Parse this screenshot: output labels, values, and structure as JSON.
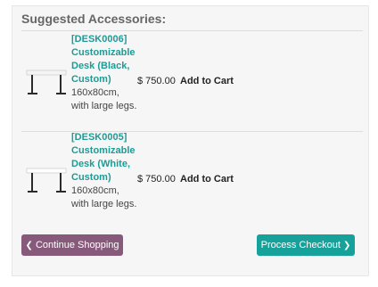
{
  "section": {
    "title": "Suggested Accessories:"
  },
  "products": [
    {
      "code": "[DESK0006]",
      "name": "Customizable Desk (Black, Custom)",
      "description": "160x80cm, with large legs.",
      "price": "$ 750.00",
      "add_label": "Add to Cart",
      "icon": "desk-image"
    },
    {
      "code": "[DESK0005]",
      "name": "Customizable Desk (White, Custom)",
      "description": "160x80cm, with large legs.",
      "price": "$ 750.00",
      "add_label": "Add to Cart",
      "icon": "desk-image"
    }
  ],
  "buttons": {
    "continue_label": "Continue Shopping",
    "checkout_label": "Process Checkout"
  },
  "colors": {
    "accent_primary": "#16a29a",
    "accent_secondary": "#875a7b",
    "product_name": "#1c9c96"
  }
}
